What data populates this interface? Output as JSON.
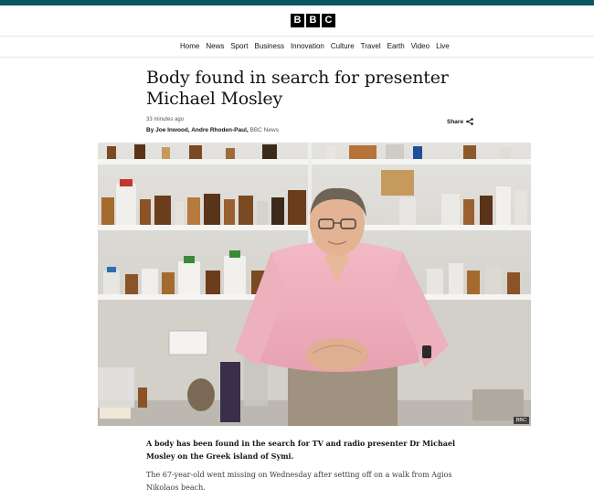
{
  "brand": {
    "logo_letters": [
      "B",
      "B",
      "C"
    ],
    "accent": "#0b5663"
  },
  "nav": {
    "items": [
      "Home",
      "News",
      "Sport",
      "Business",
      "Innovation",
      "Culture",
      "Travel",
      "Earth",
      "Video",
      "Live"
    ]
  },
  "article": {
    "headline": "Body found in search for presenter Michael Mosley",
    "timestamp": "33 minutes ago",
    "byline_prefix": "By Joe Inwood, Andre Rhoden-Paul, ",
    "byline_org": "BBC News",
    "share_label": "Share",
    "share_icon": "share-icon",
    "image_credit": "BBC",
    "lede": "A body has been found in the search for TV and radio presenter Dr Michael Mosley on the Greek island of Symi.",
    "paragraph_1": "The 67-year-old went missing on Wednesday after setting off on a walk from Agios Nikolaos beach."
  }
}
